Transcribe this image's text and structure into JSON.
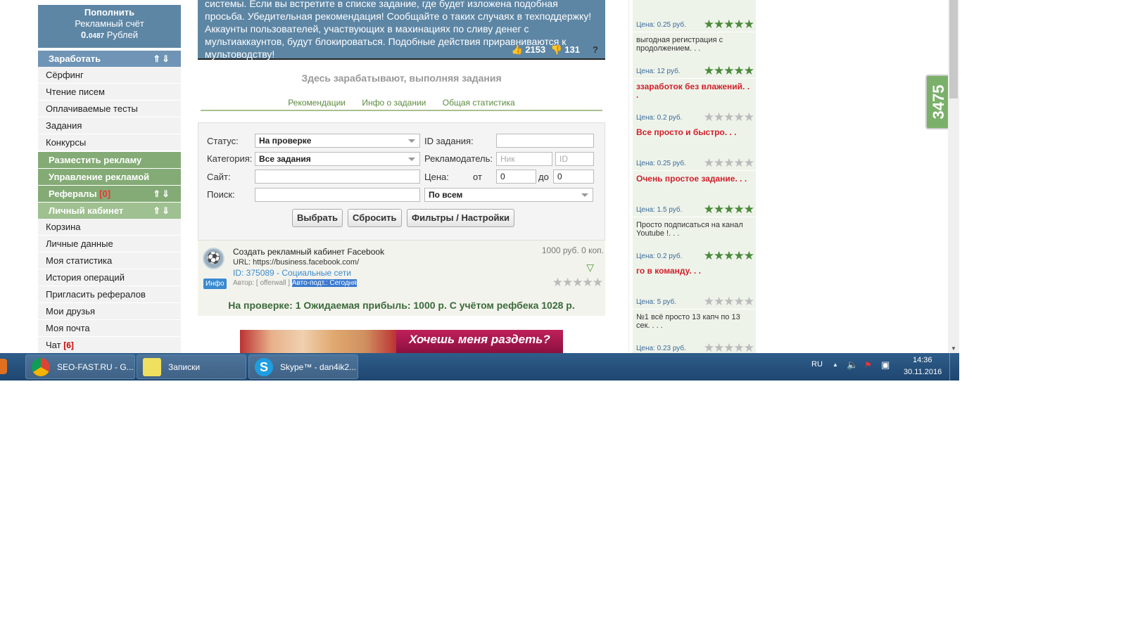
{
  "sidebar": {
    "account": {
      "line1": "Пополнить",
      "line2": "Рекламный счёт",
      "amount_int": "0.",
      "amount_dec": "0487",
      "currency": "Рублей"
    },
    "earn_header": "Заработать",
    "earn_items": [
      "Сёрфинг",
      "Чтение писем",
      "Оплачиваемые тесты",
      "Задания",
      "Конкурсы"
    ],
    "place_ad": "Разместить рекламу",
    "manage_ad": "Управление рекламой",
    "referrals": "Рефералы",
    "referrals_count": "[0]",
    "cabinet": "Личный кабинет",
    "cabinet_items": [
      "Корзина",
      "Личные данные",
      "Моя статистика",
      "История операций",
      "Пригласить рефералов",
      "Мои друзья",
      "Моя почта"
    ],
    "chat": "Чат",
    "chat_count": "[6]",
    "arrows": "⇑⇓"
  },
  "notice": {
    "text": "системы. Если вы встретите в списке задание, где будет изложена подобная просьба. Убедительная рекомендация! Сообщайте о таких случаях в техподдержку! Аккаунты пользователей, участвующих в махинациях по сливу денег с мультиаккаунтов, будут блокироваться. Подобные действия приравниваются к мультоводству!",
    "likes": "2153",
    "dislikes": "131",
    "help": "?"
  },
  "subtitle": "Здесь зарабатывают, выполняя задания",
  "tabs": [
    "Рекомендации",
    "Инфо о задании",
    "Общая статистика"
  ],
  "filter": {
    "status_label": "Статус:",
    "status_value": "На проверке",
    "category_label": "Категория:",
    "category_value": "Все задания",
    "site_label": "Сайт:",
    "search_label": "Поиск:",
    "task_id_label": "ID задания:",
    "advertiser_label": "Рекламодатель:",
    "nick_placeholder": "Ник",
    "id_placeholder": "ID",
    "price_label": "Цена:",
    "from_label": "от",
    "from_value": "0",
    "to_label": "до",
    "to_value": "0",
    "scope_value": "По всем",
    "btn_select": "Выбрать",
    "btn_reset": "Сбросить",
    "btn_filters": "Фильтры / Настройки"
  },
  "task": {
    "title": "Создать рекламный кабинет Facebook",
    "url": "URL: https://business.facebook.com/",
    "id": "ID: 375089 - Социальные сети",
    "author_prefix": "Автор: [ offerwall ]",
    "author_hl": "Авто-подт.: Сегодня",
    "price": "1000 руб. 0 коп.",
    "info": "Инфо",
    "summary": "На проверке: 1 Ожидаемая прибыль: 1000 р. С учётом рефбека 1028 р."
  },
  "banner_text": "Хочешь меня раздеть?",
  "right_items": [
    {
      "title": "",
      "price": "Цена: 0.25 руб.",
      "rating": 5,
      "red": false
    },
    {
      "title": "выгодная регистрация с продолжением. . .",
      "price": "Цена: 12 руб.",
      "rating": 5,
      "red": false
    },
    {
      "title": "ззаработок без влажений. . .",
      "price": "Цена: 0.2 руб.",
      "rating": 0,
      "red": true
    },
    {
      "title": "Все просто и быстро. . .",
      "price": "Цена: 0.25 руб.",
      "rating": 0,
      "red": true
    },
    {
      "title": "Очень простое задание. . .",
      "price": "Цена: 1.5 руб.",
      "rating": 5,
      "red": true
    },
    {
      "title": "Просто подписаться на канал Youtube !. . .",
      "price": "Цена: 0.2 руб.",
      "rating": 5,
      "red": false
    },
    {
      "title": "го в команду. . .",
      "price": "Цена: 5 руб.",
      "rating": 0,
      "red": true
    },
    {
      "title": "№1 всё просто 13 капч по 13 сек. . . .",
      "price": "Цена: 0.23 руб.",
      "rating": 0,
      "red": false
    }
  ],
  "counter": "3475",
  "taskbar": {
    "apps": [
      "SEO-FAST.RU - G...",
      "Записки",
      "Skype™ - dan4ik2..."
    ],
    "lang": "RU",
    "time": "14:36",
    "date": "30.11.2016"
  },
  "colors": {
    "header_blue": "#5d86a5",
    "menu_green": "#84ab76",
    "star_green": "#4a8a3a",
    "link_blue": "#3a8ad0",
    "red_text": "#d0202a"
  }
}
